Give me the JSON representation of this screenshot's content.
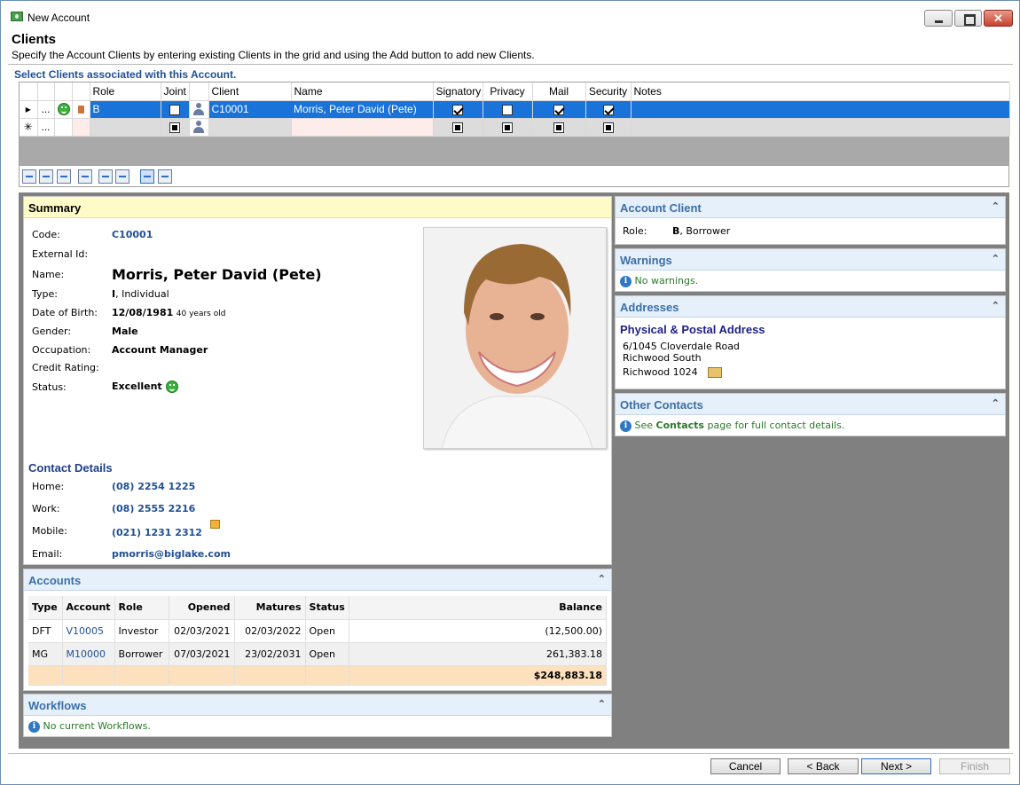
{
  "window": {
    "title": "New Account"
  },
  "header": {
    "title": "Clients",
    "description": "Specify the Account Clients by entering existing Clients in the grid and using the Add button to add new Clients."
  },
  "grid": {
    "section_title": "Select Clients associated with this Account.",
    "columns": [
      "Role",
      "Joint",
      "Client",
      "Name",
      "Signatory",
      "Privacy",
      "Mail",
      "Security",
      "Notes"
    ],
    "rows": [
      {
        "role": "B",
        "joint": false,
        "client": "C10001",
        "name": "Morris, Peter David (Pete)",
        "signatory": true,
        "privacy": false,
        "mail": true,
        "security": true,
        "notes": ""
      }
    ],
    "row_indicator": "▸",
    "new_row_indicator": "✳",
    "ellipsis": "..."
  },
  "summary": {
    "title": "Summary",
    "code_label": "Code:",
    "code": "C10001",
    "external_id_label": "External Id:",
    "external_id": "",
    "name_label": "Name:",
    "name": "Morris, Peter David (Pete)",
    "type_label": "Type:",
    "type_code": "I",
    "type_text": ", Individual",
    "dob_label": "Date of Birth:",
    "dob": "12/08/1981",
    "age": "40 years old",
    "gender_label": "Gender:",
    "gender": "Male",
    "occupation_label": "Occupation:",
    "occupation": "Account Manager",
    "credit_label": "Credit Rating:",
    "credit": "",
    "status_label": "Status:",
    "status": "Excellent"
  },
  "contact": {
    "title": "Contact Details",
    "home_label": "Home:",
    "home": "(08) 2254 1225",
    "work_label": "Work:",
    "work": "(08) 2555 2216",
    "mobile_label": "Mobile:",
    "mobile": "(021) 1231 2312",
    "email_label": "Email:",
    "email": "pmorris@biglake.com"
  },
  "accounts": {
    "title": "Accounts",
    "headers": [
      "Type",
      "Account",
      "Role",
      "Opened",
      "Matures",
      "Status",
      "Balance"
    ],
    "rows": [
      [
        "DFT",
        "V10005",
        "Investor",
        "02/03/2021",
        "02/03/2022",
        "Open",
        "(12,500.00)"
      ],
      [
        "MG",
        "M10000",
        "Borrower",
        "07/03/2021",
        "23/02/2031",
        "Open",
        "261,383.18"
      ]
    ],
    "total": "$248,883.18"
  },
  "workflows": {
    "title": "Workflows",
    "message": "No current Workflows."
  },
  "account_client": {
    "title": "Account Client",
    "role_label": "Role:",
    "role_code": "B",
    "role_text": ", Borrower"
  },
  "warnings": {
    "title": "Warnings",
    "message": "No warnings."
  },
  "addresses": {
    "title": "Addresses",
    "type": "Physical & Postal Address",
    "line1": "6/1045 Cloverdale Road",
    "line2": "Richwood South",
    "line3": "Richwood  1024"
  },
  "other_contacts": {
    "title": "Other Contacts",
    "pre": "See ",
    "link": "Contacts",
    "post": " page for full contact details."
  },
  "buttons": {
    "cancel": "Cancel",
    "back": "< Back",
    "next": "Next >",
    "finish": "Finish"
  },
  "colors": {
    "selection": "#1a73d8",
    "panel_header": "#e6f0fa",
    "summary_header": "#fffbc8",
    "link": "#1f4f96",
    "total_row": "#fde0bd",
    "status_green": "#3bb23b"
  }
}
